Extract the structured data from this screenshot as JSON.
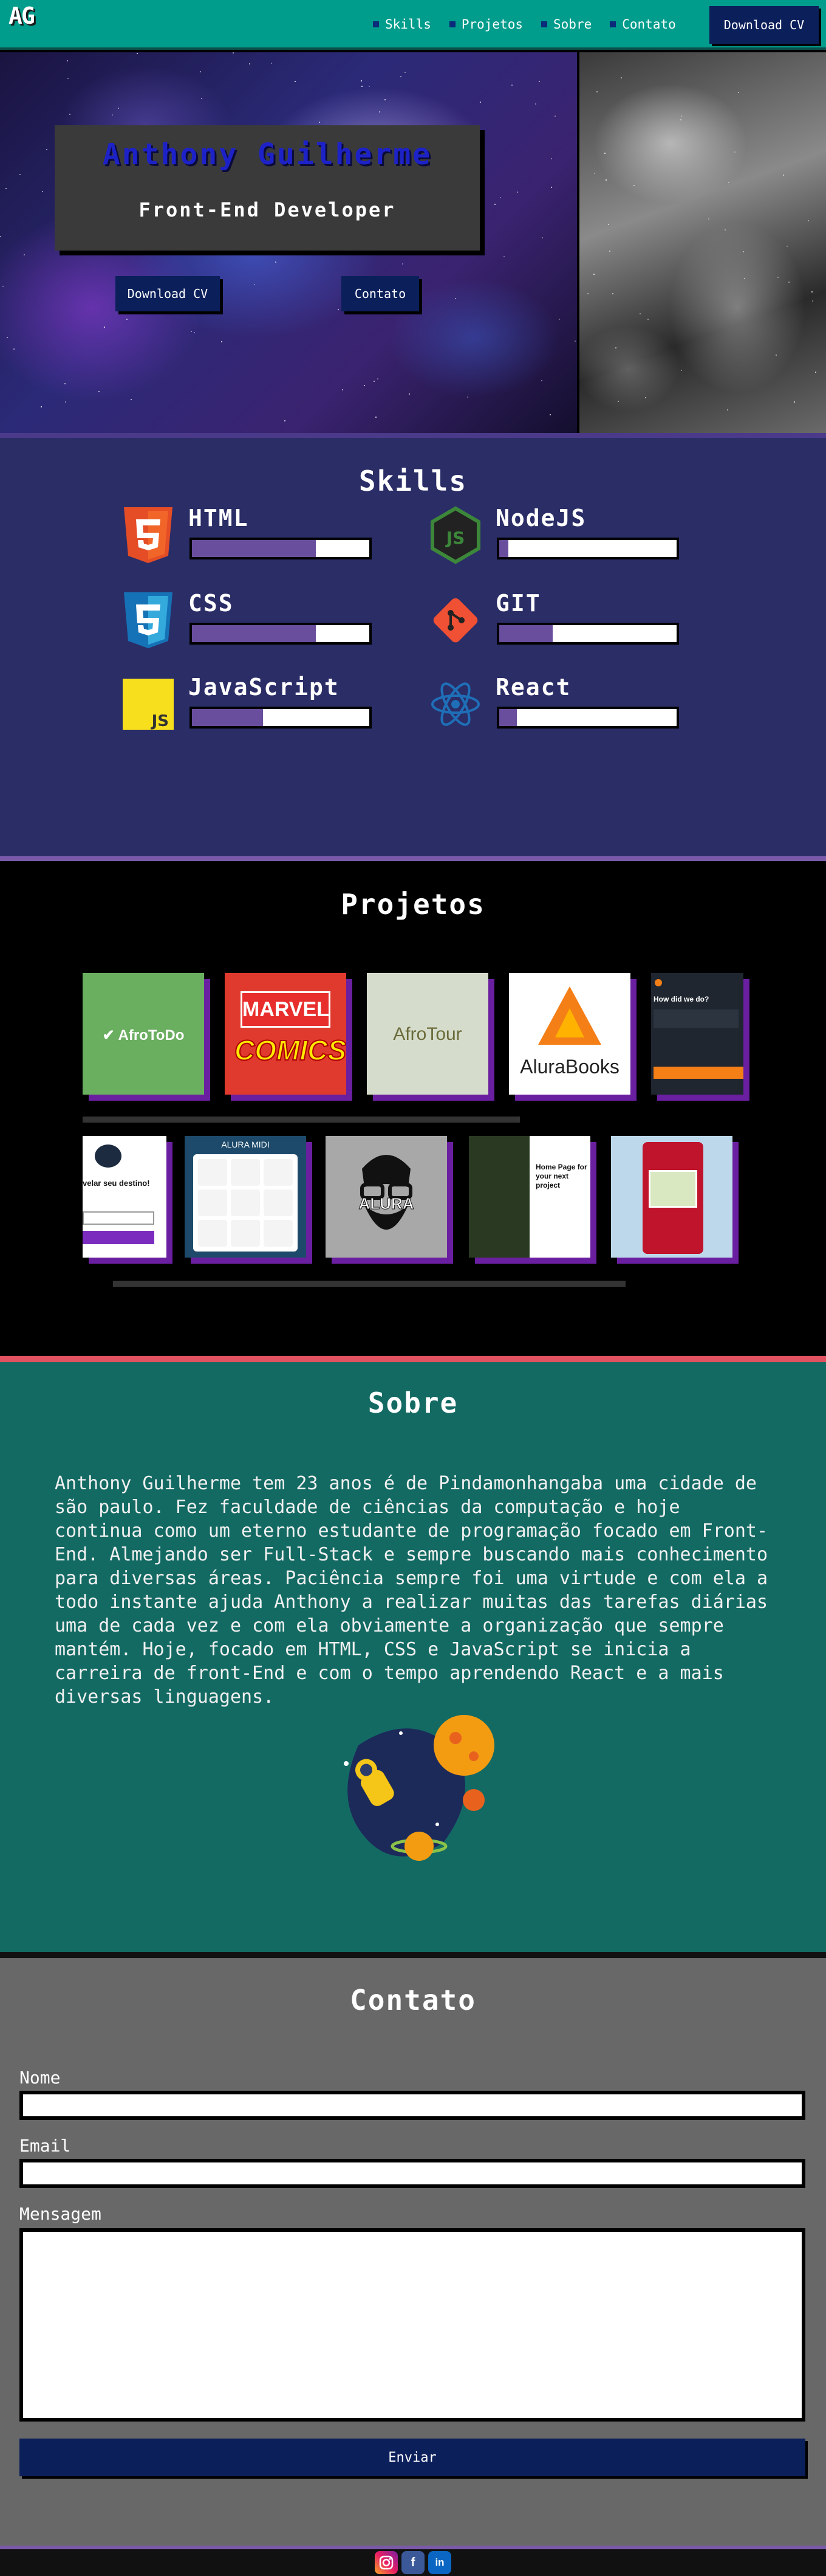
{
  "header": {
    "logo": "AG",
    "nav": [
      {
        "label": "Skills"
      },
      {
        "label": "Projetos"
      },
      {
        "label": "Sobre"
      },
      {
        "label": "Contato"
      }
    ],
    "cta_label": "Download CV"
  },
  "hero": {
    "name": "Anthony Guilherme",
    "role": "Front-End Developer",
    "cv_button": "Download CV",
    "contact_button": "Contato"
  },
  "skills": {
    "title": "Skills",
    "items": [
      {
        "name": "HTML",
        "icon": "html5-icon",
        "level": 0.7
      },
      {
        "name": "CSS",
        "icon": "css3-icon",
        "level": 0.7
      },
      {
        "name": "JavaScript",
        "icon": "javascript-icon",
        "level": 0.4
      },
      {
        "name": "NodeJS",
        "icon": "nodejs-icon",
        "level": 0.05
      },
      {
        "name": "GIT",
        "icon": "git-icon",
        "level": 0.3
      },
      {
        "name": "React",
        "icon": "react-icon",
        "level": 0.1
      }
    ]
  },
  "projects": {
    "title": "Projetos",
    "row1": [
      {
        "label": "AfroToDo"
      },
      {
        "label": "MARVEL"
      },
      {
        "label": "AfroTour"
      },
      {
        "label": "AluraBooks"
      },
      {
        "label": "How did we do?"
      }
    ],
    "row2": [
      {
        "label": "velar seu destino!"
      },
      {
        "label": "ALURA MIDI"
      },
      {
        "label": "ALURA"
      },
      {
        "label": "Home Page for your next project"
      },
      {
        "label": ""
      }
    ]
  },
  "sobre": {
    "title": "Sobre",
    "text": "Anthony Guilherme tem 23 anos é de Pindamonhangaba uma cidade de são paulo. Fez faculdade de ciências da computação e hoje continua como um eterno estudante de programação focado em Front-End. Almejando ser Full-Stack e sempre buscando mais conhecimento para diversas áreas. Paciência sempre foi uma virtude e com ela a todo instante ajuda Anthony a realizar muitas das tarefas diárias uma de cada vez e com ela obviamente a organização que sempre mantém. Hoje, focado em HTML, CSS e JavaScript se inicia a carreira de front-End e com o tempo aprendendo React e a mais diversas linguagens."
  },
  "contato": {
    "title": "Contato",
    "nome_label": "Nome",
    "email_label": "Email",
    "mensagem_label": "Mensagem",
    "submit": "Enviar"
  },
  "footer": {
    "social": [
      {
        "icon": "instagram-icon"
      },
      {
        "icon": "facebook-icon"
      },
      {
        "icon": "linkedin-icon"
      }
    ]
  },
  "colors": {
    "header_bg": "#009c8c",
    "button_bg": "#0b1f5a",
    "skills_bg": "#2b2d67",
    "skill_fill": "#6a4e9e",
    "sobre_bg": "#136a63",
    "contato_bg": "#686868",
    "project_shadow": "#6a1fa0"
  }
}
